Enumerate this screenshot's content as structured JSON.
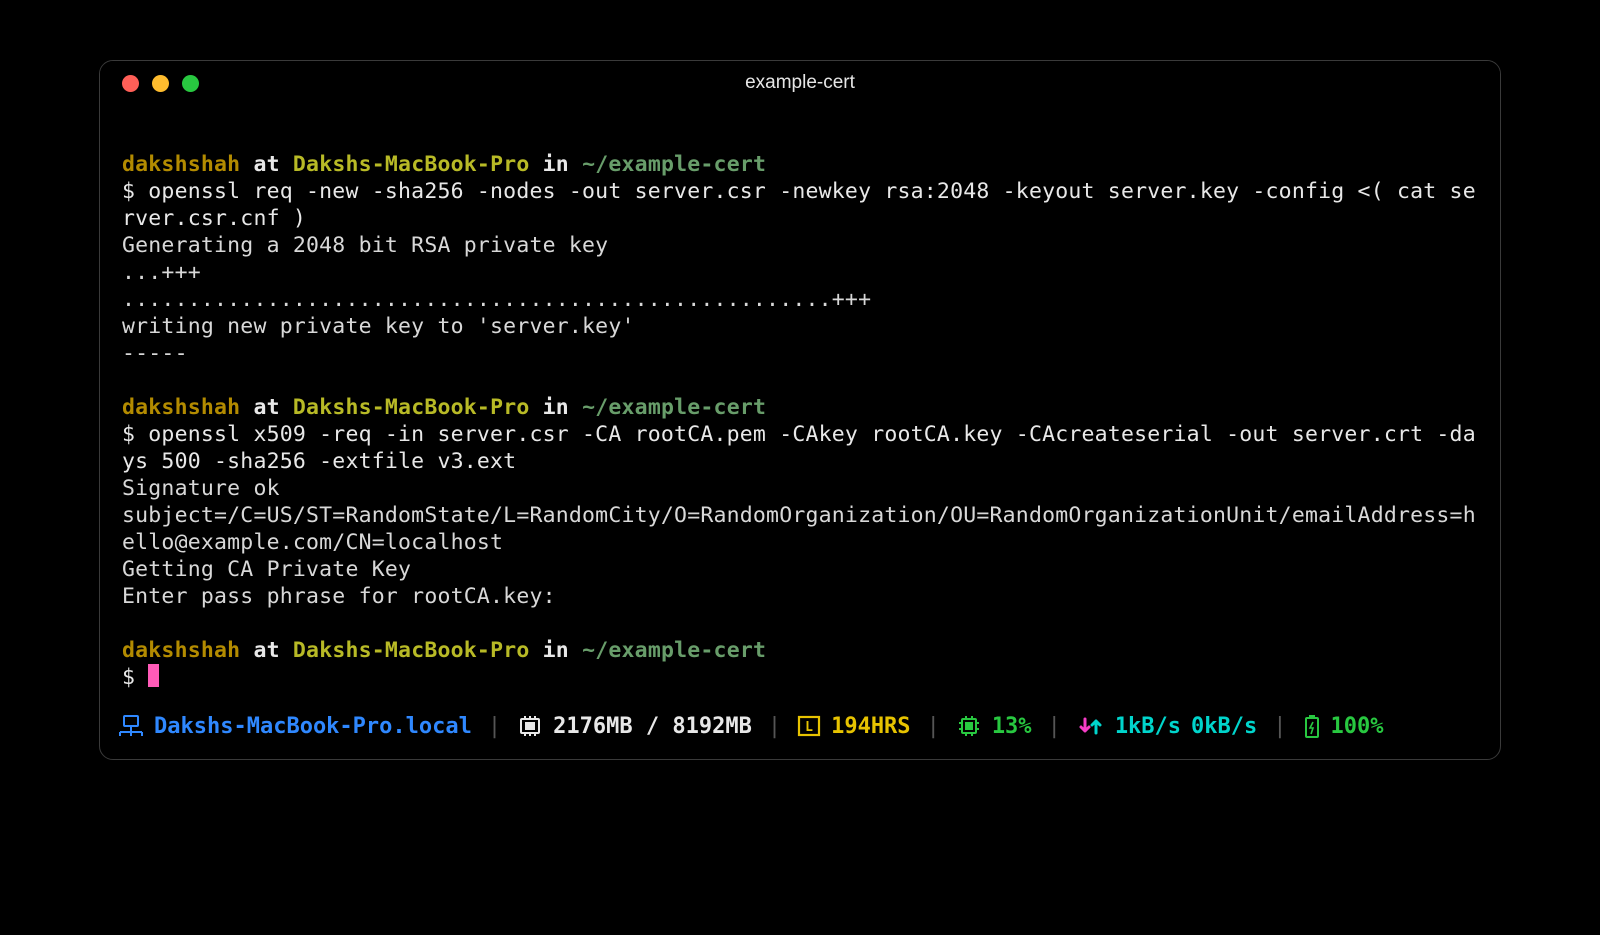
{
  "window": {
    "title": "example-cert"
  },
  "prompt1": {
    "user": "dakshshah",
    "at": "at",
    "host": "Dakshs-MacBook-Pro",
    "in": "in",
    "path": "~/example-cert"
  },
  "cmd1": "$ openssl req -new -sha256 -nodes -out server.csr -newkey rsa:2048 -keyout server.key -config <( cat server.csr.cnf )",
  "output1": "Generating a 2048 bit RSA private key\n...+++\n......................................................+++\nwriting new private key to 'server.key'\n-----",
  "prompt2": {
    "user": "dakshshah",
    "at": "at",
    "host": "Dakshs-MacBook-Pro",
    "in": "in",
    "path": "~/example-cert"
  },
  "cmd2": "$ openssl x509 -req -in server.csr -CA rootCA.pem -CAkey rootCA.key -CAcreateserial -out server.crt -days 500 -sha256 -extfile v3.ext",
  "output2": "Signature ok\nsubject=/C=US/ST=RandomState/L=RandomCity/O=RandomOrganization/OU=RandomOrganizationUnit/emailAddress=hello@example.com/CN=localhost\nGetting CA Private Key\nEnter pass phrase for rootCA.key:",
  "prompt3": {
    "user": "dakshshah",
    "at": "at",
    "host": "Dakshs-MacBook-Pro",
    "in": "in",
    "path": "~/example-cert"
  },
  "cmd3": "$ ",
  "statusbar": {
    "hostname": "Dakshs-MacBook-Pro.local",
    "memory": "2176MB / 8192MB",
    "hours": "194HRS",
    "cpu": "13%",
    "net_down": "1kB/s",
    "net_up": "0kB/s",
    "battery": "100%"
  }
}
